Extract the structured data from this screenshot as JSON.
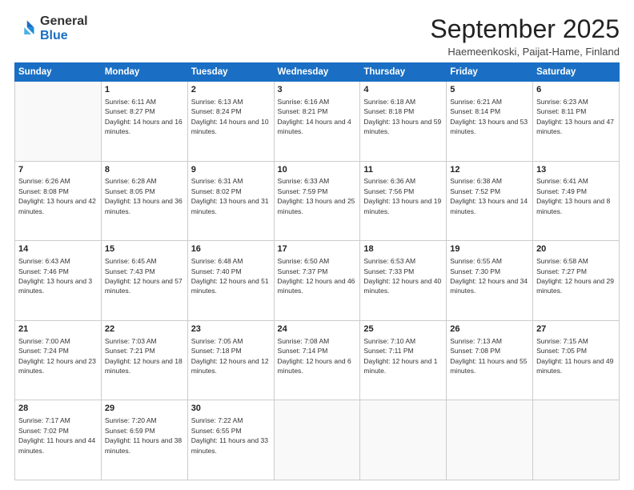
{
  "logo": {
    "general": "General",
    "blue": "Blue"
  },
  "header": {
    "month": "September 2025",
    "location": "Haemeenkoski, Paijat-Hame, Finland"
  },
  "weekdays": [
    "Sunday",
    "Monday",
    "Tuesday",
    "Wednesday",
    "Thursday",
    "Friday",
    "Saturday"
  ],
  "weeks": [
    [
      {
        "day": "",
        "sunrise": "",
        "sunset": "",
        "daylight": ""
      },
      {
        "day": "1",
        "sunrise": "Sunrise: 6:11 AM",
        "sunset": "Sunset: 8:27 PM",
        "daylight": "Daylight: 14 hours and 16 minutes."
      },
      {
        "day": "2",
        "sunrise": "Sunrise: 6:13 AM",
        "sunset": "Sunset: 8:24 PM",
        "daylight": "Daylight: 14 hours and 10 minutes."
      },
      {
        "day": "3",
        "sunrise": "Sunrise: 6:16 AM",
        "sunset": "Sunset: 8:21 PM",
        "daylight": "Daylight: 14 hours and 4 minutes."
      },
      {
        "day": "4",
        "sunrise": "Sunrise: 6:18 AM",
        "sunset": "Sunset: 8:18 PM",
        "daylight": "Daylight: 13 hours and 59 minutes."
      },
      {
        "day": "5",
        "sunrise": "Sunrise: 6:21 AM",
        "sunset": "Sunset: 8:14 PM",
        "daylight": "Daylight: 13 hours and 53 minutes."
      },
      {
        "day": "6",
        "sunrise": "Sunrise: 6:23 AM",
        "sunset": "Sunset: 8:11 PM",
        "daylight": "Daylight: 13 hours and 47 minutes."
      }
    ],
    [
      {
        "day": "7",
        "sunrise": "Sunrise: 6:26 AM",
        "sunset": "Sunset: 8:08 PM",
        "daylight": "Daylight: 13 hours and 42 minutes."
      },
      {
        "day": "8",
        "sunrise": "Sunrise: 6:28 AM",
        "sunset": "Sunset: 8:05 PM",
        "daylight": "Daylight: 13 hours and 36 minutes."
      },
      {
        "day": "9",
        "sunrise": "Sunrise: 6:31 AM",
        "sunset": "Sunset: 8:02 PM",
        "daylight": "Daylight: 13 hours and 31 minutes."
      },
      {
        "day": "10",
        "sunrise": "Sunrise: 6:33 AM",
        "sunset": "Sunset: 7:59 PM",
        "daylight": "Daylight: 13 hours and 25 minutes."
      },
      {
        "day": "11",
        "sunrise": "Sunrise: 6:36 AM",
        "sunset": "Sunset: 7:56 PM",
        "daylight": "Daylight: 13 hours and 19 minutes."
      },
      {
        "day": "12",
        "sunrise": "Sunrise: 6:38 AM",
        "sunset": "Sunset: 7:52 PM",
        "daylight": "Daylight: 13 hours and 14 minutes."
      },
      {
        "day": "13",
        "sunrise": "Sunrise: 6:41 AM",
        "sunset": "Sunset: 7:49 PM",
        "daylight": "Daylight: 13 hours and 8 minutes."
      }
    ],
    [
      {
        "day": "14",
        "sunrise": "Sunrise: 6:43 AM",
        "sunset": "Sunset: 7:46 PM",
        "daylight": "Daylight: 13 hours and 3 minutes."
      },
      {
        "day": "15",
        "sunrise": "Sunrise: 6:45 AM",
        "sunset": "Sunset: 7:43 PM",
        "daylight": "Daylight: 12 hours and 57 minutes."
      },
      {
        "day": "16",
        "sunrise": "Sunrise: 6:48 AM",
        "sunset": "Sunset: 7:40 PM",
        "daylight": "Daylight: 12 hours and 51 minutes."
      },
      {
        "day": "17",
        "sunrise": "Sunrise: 6:50 AM",
        "sunset": "Sunset: 7:37 PM",
        "daylight": "Daylight: 12 hours and 46 minutes."
      },
      {
        "day": "18",
        "sunrise": "Sunrise: 6:53 AM",
        "sunset": "Sunset: 7:33 PM",
        "daylight": "Daylight: 12 hours and 40 minutes."
      },
      {
        "day": "19",
        "sunrise": "Sunrise: 6:55 AM",
        "sunset": "Sunset: 7:30 PM",
        "daylight": "Daylight: 12 hours and 34 minutes."
      },
      {
        "day": "20",
        "sunrise": "Sunrise: 6:58 AM",
        "sunset": "Sunset: 7:27 PM",
        "daylight": "Daylight: 12 hours and 29 minutes."
      }
    ],
    [
      {
        "day": "21",
        "sunrise": "Sunrise: 7:00 AM",
        "sunset": "Sunset: 7:24 PM",
        "daylight": "Daylight: 12 hours and 23 minutes."
      },
      {
        "day": "22",
        "sunrise": "Sunrise: 7:03 AM",
        "sunset": "Sunset: 7:21 PM",
        "daylight": "Daylight: 12 hours and 18 minutes."
      },
      {
        "day": "23",
        "sunrise": "Sunrise: 7:05 AM",
        "sunset": "Sunset: 7:18 PM",
        "daylight": "Daylight: 12 hours and 12 minutes."
      },
      {
        "day": "24",
        "sunrise": "Sunrise: 7:08 AM",
        "sunset": "Sunset: 7:14 PM",
        "daylight": "Daylight: 12 hours and 6 minutes."
      },
      {
        "day": "25",
        "sunrise": "Sunrise: 7:10 AM",
        "sunset": "Sunset: 7:11 PM",
        "daylight": "Daylight: 12 hours and 1 minute."
      },
      {
        "day": "26",
        "sunrise": "Sunrise: 7:13 AM",
        "sunset": "Sunset: 7:08 PM",
        "daylight": "Daylight: 11 hours and 55 minutes."
      },
      {
        "day": "27",
        "sunrise": "Sunrise: 7:15 AM",
        "sunset": "Sunset: 7:05 PM",
        "daylight": "Daylight: 11 hours and 49 minutes."
      }
    ],
    [
      {
        "day": "28",
        "sunrise": "Sunrise: 7:17 AM",
        "sunset": "Sunset: 7:02 PM",
        "daylight": "Daylight: 11 hours and 44 minutes."
      },
      {
        "day": "29",
        "sunrise": "Sunrise: 7:20 AM",
        "sunset": "Sunset: 6:59 PM",
        "daylight": "Daylight: 11 hours and 38 minutes."
      },
      {
        "day": "30",
        "sunrise": "Sunrise: 7:22 AM",
        "sunset": "Sunset: 6:55 PM",
        "daylight": "Daylight: 11 hours and 33 minutes."
      },
      {
        "day": "",
        "sunrise": "",
        "sunset": "",
        "daylight": ""
      },
      {
        "day": "",
        "sunrise": "",
        "sunset": "",
        "daylight": ""
      },
      {
        "day": "",
        "sunrise": "",
        "sunset": "",
        "daylight": ""
      },
      {
        "day": "",
        "sunrise": "",
        "sunset": "",
        "daylight": ""
      }
    ]
  ]
}
